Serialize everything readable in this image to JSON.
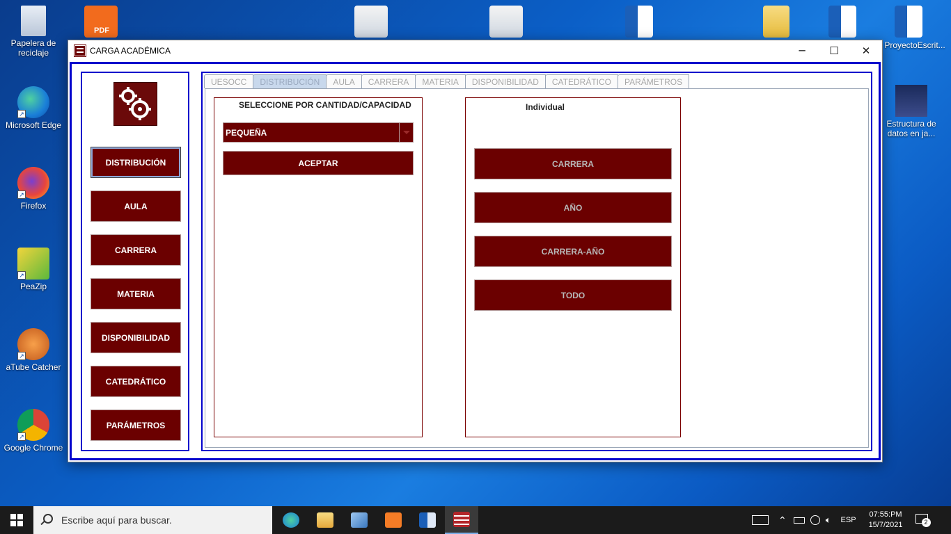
{
  "desktop": {
    "icons_left": [
      {
        "name": "recycle-bin-icon",
        "label": "Papelera de reciclaje"
      },
      {
        "name": "edge-icon",
        "label": "Microsoft Edge"
      },
      {
        "name": "firefox-icon",
        "label": "Firefox"
      },
      {
        "name": "peazip-icon",
        "label": "PeaZip"
      },
      {
        "name": "atube-catcher-icon",
        "label": "aTube Catcher"
      },
      {
        "name": "chrome-icon",
        "label": "Google Chrome"
      }
    ],
    "icons_right": [
      {
        "name": "word-doc-icon",
        "label": "ProyectoEscrit..."
      },
      {
        "name": "book-icon",
        "label": "Estructura de datos en ja..."
      }
    ],
    "pdf_badge": "PDF"
  },
  "window": {
    "title": "CARGA ACADÉMICA",
    "minimize": "─",
    "maximize": "☐",
    "close": "✕"
  },
  "sidebar": {
    "items": [
      {
        "label": "DISTRIBUCIÓN",
        "active": true
      },
      {
        "label": "AULA"
      },
      {
        "label": "CARRERA"
      },
      {
        "label": "MATERIA"
      },
      {
        "label": "DISPONIBILIDAD"
      },
      {
        "label": "CATEDRÁTICO"
      },
      {
        "label": "PARÁMETROS"
      }
    ]
  },
  "tabs": [
    {
      "label": "UESOCC"
    },
    {
      "label": "DISTRIBUCIÓN",
      "active": true
    },
    {
      "label": "AULA"
    },
    {
      "label": "CARRERA"
    },
    {
      "label": "MATERIA"
    },
    {
      "label": "DISPONIBILIDAD"
    },
    {
      "label": "CATEDRÁTICO"
    },
    {
      "label": "PARÁMETROS"
    }
  ],
  "capacity_panel": {
    "title": "SELECCIONE POR CANTIDAD/CAPACIDAD",
    "selected": "PEQUEÑA",
    "accept_label": "ACEPTAR"
  },
  "individual_panel": {
    "title": "Individual",
    "buttons": [
      "CARRERA",
      "AÑO",
      "CARRERA-AÑO",
      "TODO"
    ]
  },
  "taskbar": {
    "search_placeholder": "Escribe aquí para buscar.",
    "language": "ESP",
    "time": "07:55:PM",
    "date": "15/7/2021",
    "notifications": "2"
  },
  "colors": {
    "button_bg": "#6b0000",
    "border_blue": "#0000cc",
    "disabled_text": "#b8b8b8"
  }
}
